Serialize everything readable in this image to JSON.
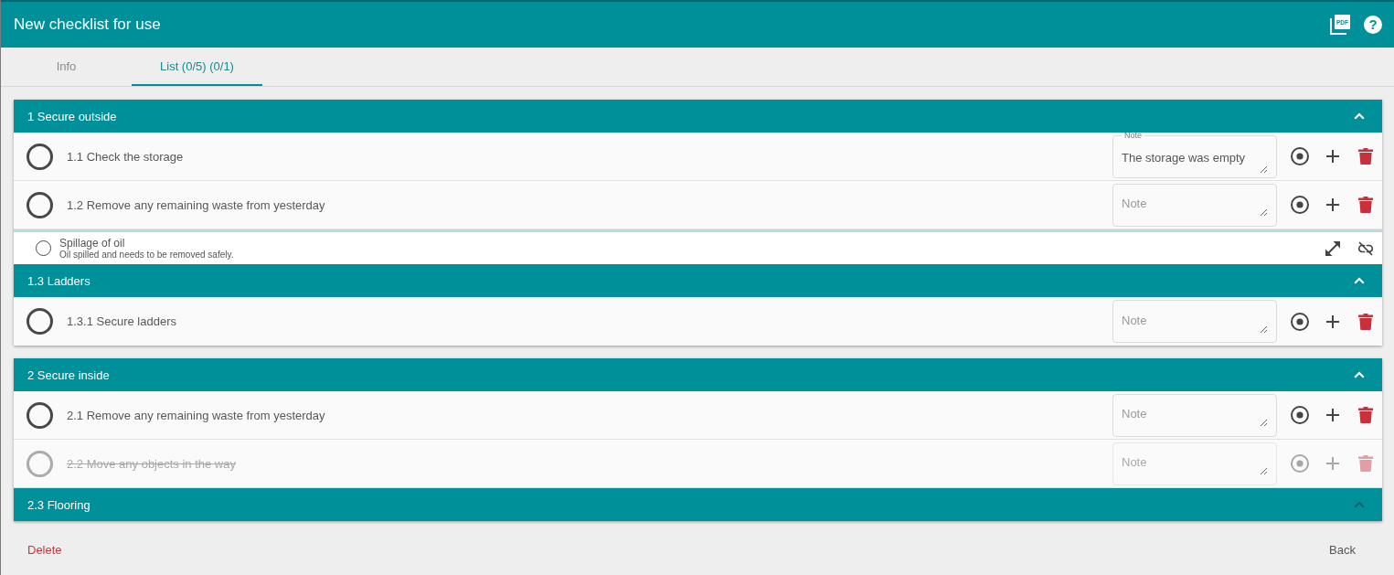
{
  "header": {
    "title": "New checklist for use",
    "pdf_button": "PDF",
    "help_button": "?"
  },
  "tabs": [
    {
      "label": "Info",
      "selected": false
    },
    {
      "label": "List (0/5) (0/1)",
      "selected": true
    }
  ],
  "sections": [
    {
      "title": "1 Secure outside",
      "expanded": true,
      "disabled": false,
      "items": [
        {
          "kind": "task",
          "label": "1.1 Check the storage",
          "checked": false,
          "disabled": false,
          "note": {
            "label": "Note",
            "value": "The storage was empty"
          }
        },
        {
          "kind": "task",
          "label": "1.2 Remove any remaining waste from yesterday",
          "checked": false,
          "disabled": false,
          "note": {
            "placeholder": "Note"
          },
          "deviations": [
            {
              "title": "Spillage of oil",
              "description": "Oil spilled and needs to be removed safely.",
              "checked": false
            }
          ]
        },
        {
          "kind": "subsection",
          "title": "1.3 Ladders",
          "expanded": true,
          "disabled": false,
          "items": [
            {
              "kind": "task",
              "label": "1.3.1 Secure ladders",
              "checked": false,
              "disabled": false,
              "note": {
                "placeholder": "Note"
              }
            }
          ]
        }
      ]
    },
    {
      "title": "2 Secure inside",
      "expanded": true,
      "disabled": false,
      "items": [
        {
          "kind": "task",
          "label": "2.1 Remove any remaining waste from yesterday",
          "checked": false,
          "disabled": false,
          "note": {
            "placeholder": "Note"
          }
        },
        {
          "kind": "task",
          "label": "2.2 Move any objects in the way",
          "checked": false,
          "disabled": true,
          "note": {
            "placeholder": "Note"
          }
        },
        {
          "kind": "subsection",
          "title": "2.3 Flooring",
          "expanded": true,
          "disabled": true
        }
      ]
    }
  ],
  "footer": {
    "buttons": [
      {
        "kind": "danger",
        "label": "Delete"
      },
      {
        "kind": "plain",
        "label": "Back"
      }
    ]
  }
}
